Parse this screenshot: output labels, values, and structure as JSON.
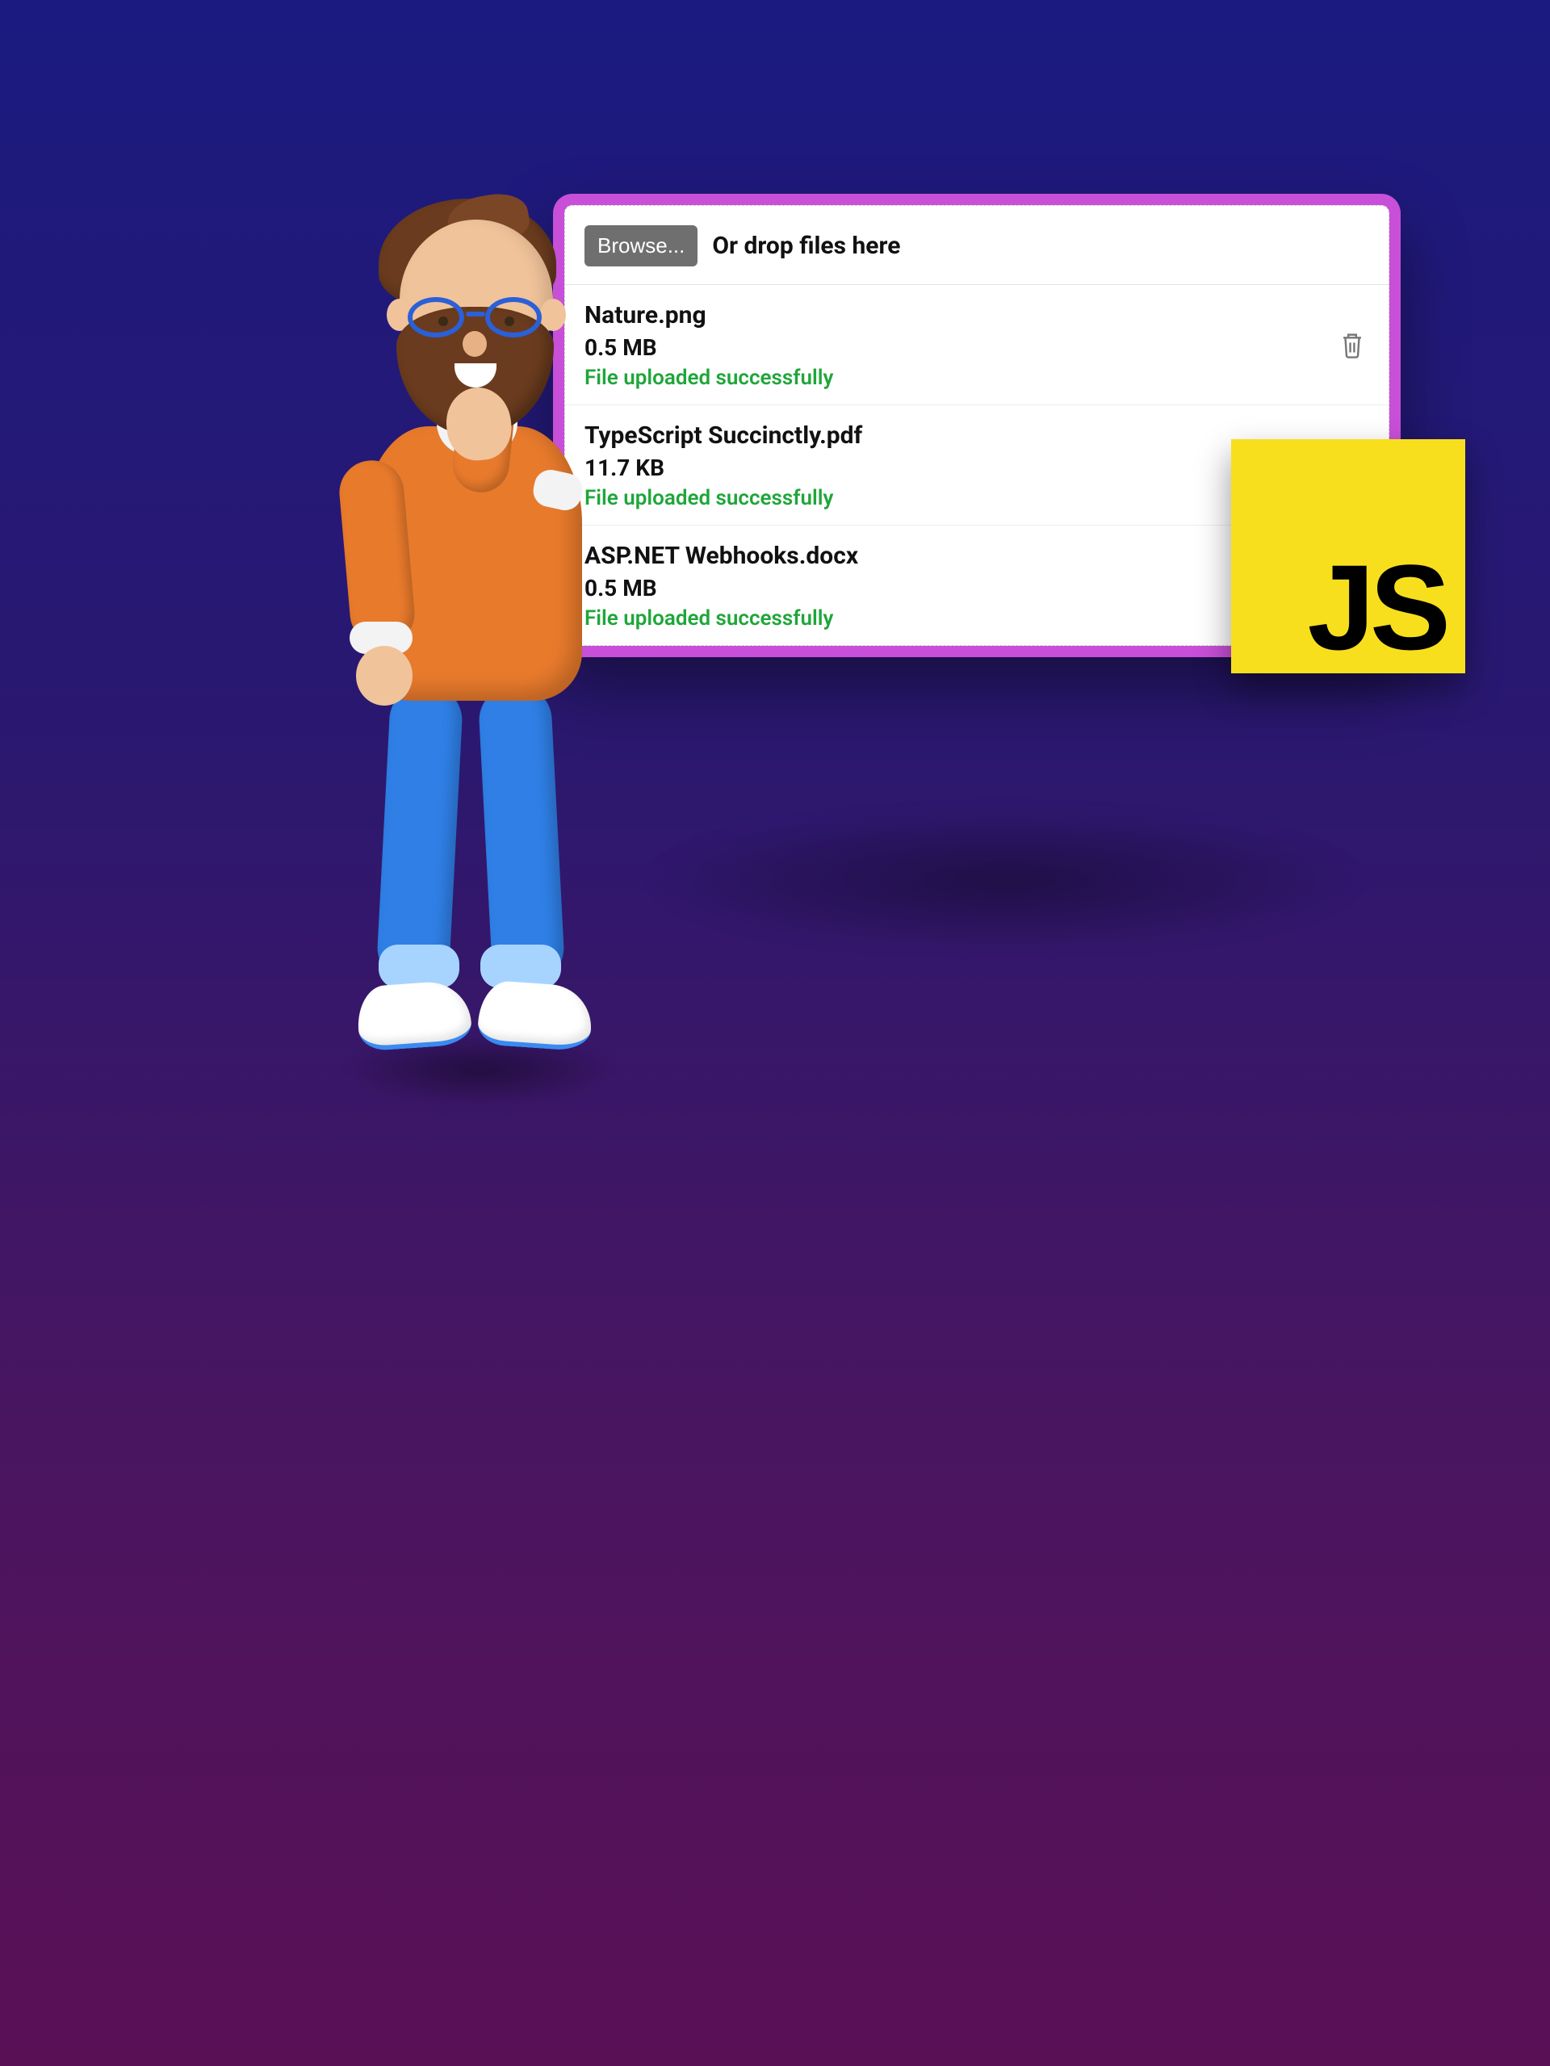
{
  "colors": {
    "panel_border": "#c84fd8",
    "success": "#1fa63a",
    "js_bg": "#f7df1e"
  },
  "uploader": {
    "browse_label": "Browse...",
    "drop_label": "Or drop files here",
    "success_message": "File uploaded successfully",
    "files": [
      {
        "name": "Nature.png",
        "size": "0.5 MB",
        "status": "File uploaded successfully"
      },
      {
        "name": "TypeScript Succinctly.pdf",
        "size": "11.7 KB",
        "status": "File uploaded successfully"
      },
      {
        "name": "ASP.NET Webhooks.docx",
        "size": "0.5 MB",
        "status": "File uploaded successfully"
      }
    ]
  },
  "badge": {
    "js_label": "JS"
  }
}
